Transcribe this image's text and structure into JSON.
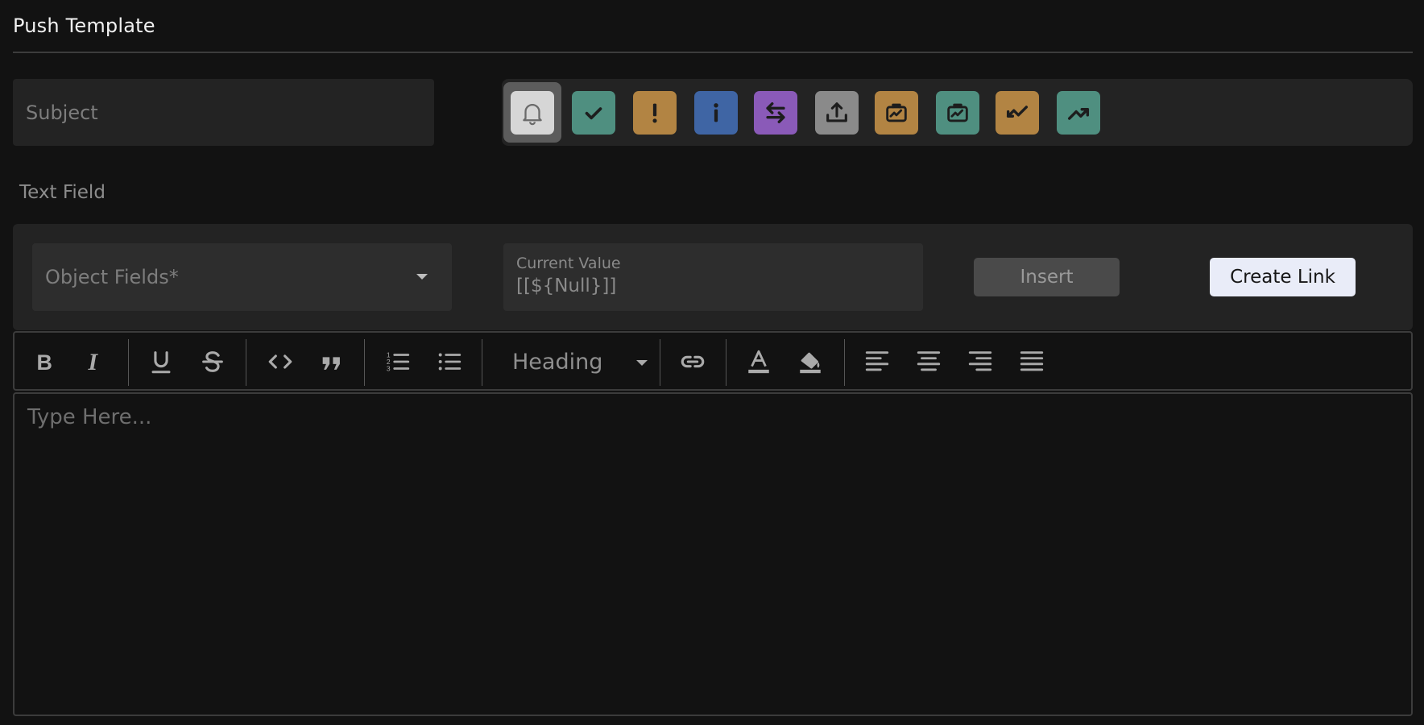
{
  "header": {
    "title": "Push Template"
  },
  "subject": {
    "placeholder": "Subject"
  },
  "icon_bar": {
    "selected_index": 0,
    "icons": [
      {
        "name": "bell-icon",
        "bg": "#d6d6d6",
        "fg": "#6a6a6a"
      },
      {
        "name": "checkmark-icon",
        "bg": "#4f8f80",
        "fg": "#1d1d1d"
      },
      {
        "name": "exclamation-icon",
        "bg": "#b28443",
        "fg": "#1d1d1d"
      },
      {
        "name": "info-icon",
        "bg": "#3f65a4",
        "fg": "#1d1d1d"
      },
      {
        "name": "swap-arrows-icon",
        "bg": "#8a5ab8",
        "fg": "#1d1d1d"
      },
      {
        "name": "upload-icon",
        "bg": "#8a8a8a",
        "fg": "#1d1d1d"
      },
      {
        "name": "briefcase-chart-icon",
        "bg": "#b28443",
        "fg": "#1d1d1d"
      },
      {
        "name": "briefcase-chart-icon",
        "bg": "#4f8f80",
        "fg": "#1d1d1d"
      },
      {
        "name": "trend-down-icon",
        "bg": "#b28443",
        "fg": "#1d1d1d"
      },
      {
        "name": "trend-up-icon",
        "bg": "#4f8f80",
        "fg": "#1d1d1d"
      }
    ]
  },
  "text_field": {
    "label": "Text Field",
    "object_fields_placeholder": "Object Fields*",
    "current_value_label": "Current Value",
    "current_value": "[[${Null}]]",
    "insert_label": "Insert",
    "create_link_label": "Create Link"
  },
  "toolbar": {
    "heading_label": "Heading",
    "tools": [
      "bold-icon",
      "italic-icon",
      "underline-icon",
      "strikethrough-icon",
      "code-icon",
      "quote-icon",
      "ordered-list-icon",
      "bullet-list-icon",
      "link-icon",
      "text-color-icon",
      "fill-color-icon",
      "align-left-icon",
      "align-center-icon",
      "align-right-icon",
      "align-justify-icon"
    ]
  },
  "editor": {
    "placeholder": "Type Here..."
  }
}
